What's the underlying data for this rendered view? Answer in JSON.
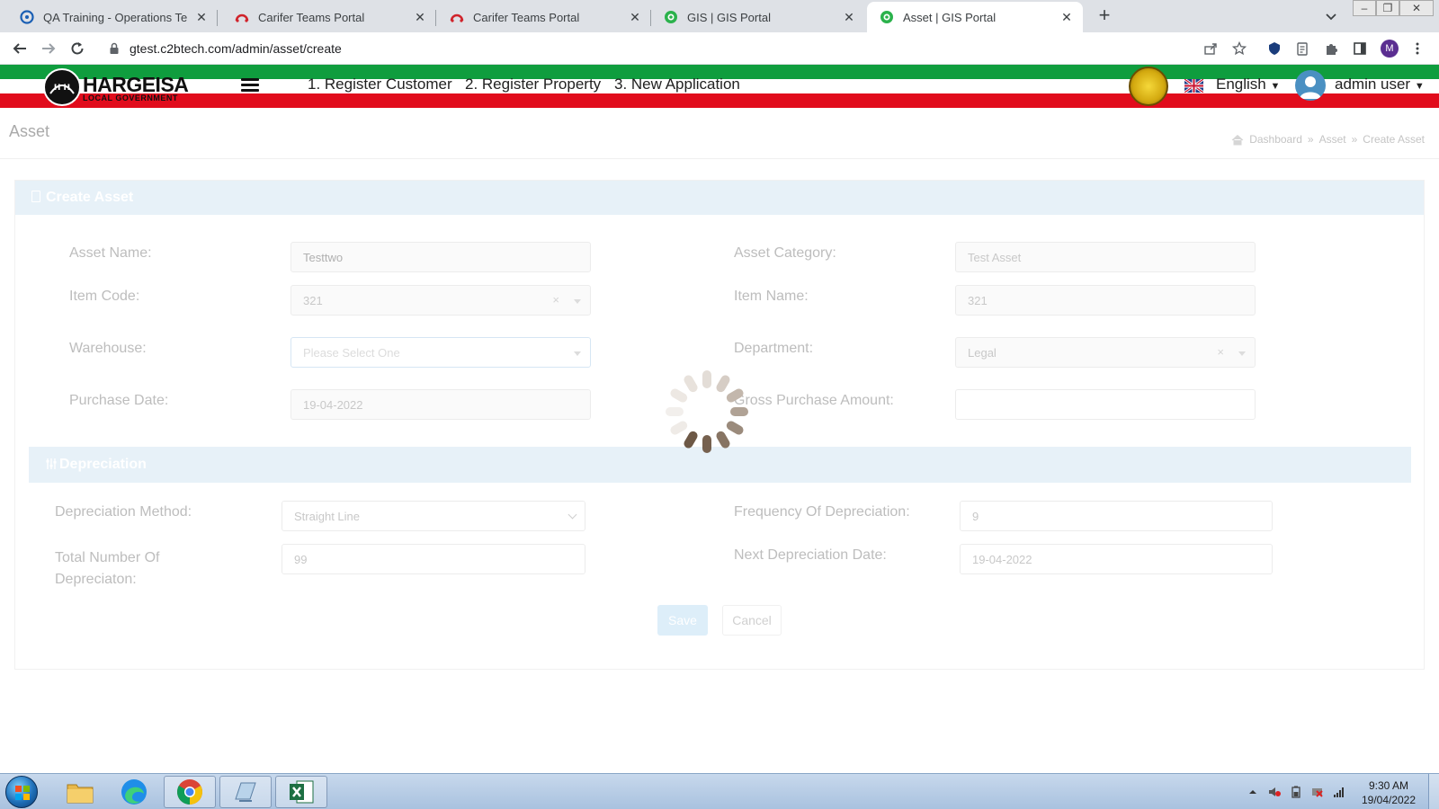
{
  "browser": {
    "tabs": [
      {
        "title": "QA Training - Operations Team C",
        "favicon": "qa-icon",
        "active": false
      },
      {
        "title": "Carifer Teams Portal",
        "favicon": "carifer-icon",
        "active": false
      },
      {
        "title": "Carifer Teams Portal",
        "favicon": "carifer-icon",
        "active": false
      },
      {
        "title": "GIS | GIS Portal",
        "favicon": "gis-icon",
        "active": false
      },
      {
        "title": "Asset | GIS Portal",
        "favicon": "gis-icon",
        "active": true
      }
    ],
    "url": "gtest.c2btech.com/admin/asset/create",
    "profile_initial": "M"
  },
  "header": {
    "logo_text": "HARGEISA",
    "logo_sub": "LOCAL GOVERNMENT",
    "nav": [
      "1. Register Customer",
      "2. Register Property",
      "3. New Application"
    ],
    "language": "English",
    "user": "admin user",
    "colors": {
      "green": "#0f9d3e",
      "red": "#e10c1c"
    }
  },
  "page": {
    "title": "Asset",
    "breadcrumb": [
      "Dashboard",
      "Asset",
      "Create Asset"
    ]
  },
  "form": {
    "card_title": "Create Asset",
    "fields": {
      "asset_name": {
        "label": "Asset Name:",
        "value": "Testtwo"
      },
      "asset_category": {
        "label": "Asset Category:",
        "value": "Test Asset"
      },
      "item_code": {
        "label": "Item Code:",
        "value": "321"
      },
      "item_name": {
        "label": "Item Name:",
        "value": "321"
      },
      "warehouse": {
        "label": "Warehouse:",
        "value": "Please Select One"
      },
      "department": {
        "label": "Department:",
        "value": "Legal"
      },
      "purchase_date": {
        "label": "Purchase Date:",
        "value": "19-04-2022"
      },
      "gross_purchase_amount": {
        "label": "Gross Purchase Amount:",
        "value": ""
      }
    },
    "depreciation": {
      "title": "Depreciation",
      "method": {
        "label": "Depreciation Method:",
        "value": "Straight Line"
      },
      "frequency": {
        "label": "Frequency Of Depreciation:",
        "value": "9"
      },
      "total_number": {
        "label_line1": "Total Number Of",
        "label_line2": "Depreciaton:",
        "value": "99"
      },
      "next_date": {
        "label": "Next Depreciation Date:",
        "value": "19-04-2022"
      }
    },
    "buttons": {
      "save": "Save",
      "cancel": "Cancel"
    }
  },
  "loading": true,
  "taskbar": {
    "apps": [
      "file-explorer-icon",
      "edge-icon",
      "chrome-icon",
      "notepad-icon",
      "excel-icon"
    ],
    "time": "9:30 AM",
    "date": "19/04/2022"
  }
}
